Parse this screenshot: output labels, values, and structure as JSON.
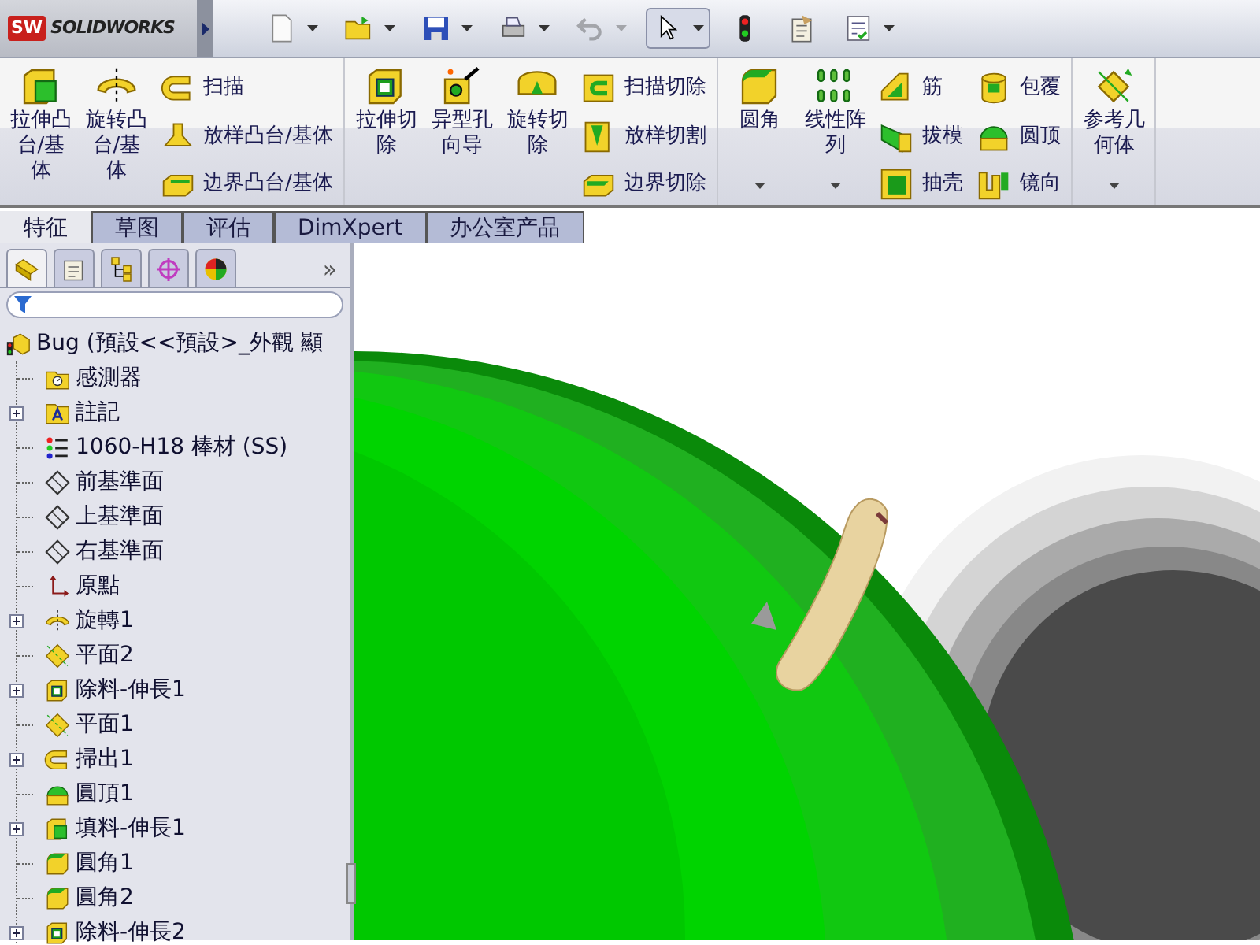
{
  "app": {
    "logo_mark": "SW",
    "logo_text": "SOLIDWORKS"
  },
  "quick_toolbar": [
    {
      "kind": "new",
      "dropdown": true,
      "disabled": false,
      "selected": false
    },
    {
      "kind": "open",
      "dropdown": true,
      "disabled": false,
      "selected": false
    },
    {
      "kind": "save",
      "dropdown": true,
      "disabled": false,
      "selected": false
    },
    {
      "kind": "print",
      "dropdown": true,
      "disabled": false,
      "selected": false
    },
    {
      "kind": "undo",
      "dropdown": true,
      "disabled": true,
      "selected": false
    },
    {
      "kind": "select",
      "dropdown": true,
      "disabled": false,
      "selected": true
    },
    {
      "kind": "rebuild",
      "dropdown": false,
      "disabled": false,
      "selected": false
    },
    {
      "kind": "options",
      "dropdown": false,
      "disabled": false,
      "selected": false
    },
    {
      "kind": "checklist",
      "dropdown": true,
      "disabled": false,
      "selected": false
    }
  ],
  "ribbon": {
    "groups": [
      {
        "columns": [
          {
            "kind": "large",
            "items": [
              {
                "label": "拉伸凸台/基体",
                "kind": "extrude",
                "dropdown": false
              }
            ]
          },
          {
            "kind": "large",
            "items": [
              {
                "label": "旋转凸台/基体",
                "kind": "revolve",
                "dropdown": false
              }
            ]
          },
          {
            "kind": "stack",
            "items": [
              {
                "label": "扫描",
                "kind": "sweep"
              },
              {
                "label": "放样凸台/基体",
                "kind": "loft"
              },
              {
                "label": "边界凸台/基体",
                "kind": "boundary"
              }
            ]
          }
        ]
      },
      {
        "columns": [
          {
            "kind": "large",
            "items": [
              {
                "label": "拉伸切除",
                "kind": "cut",
                "dropdown": false
              }
            ]
          },
          {
            "kind": "large",
            "items": [
              {
                "label": "异型孔向导",
                "kind": "hole",
                "dropdown": false
              }
            ]
          },
          {
            "kind": "large",
            "items": [
              {
                "label": "旋转切除",
                "kind": "revcut",
                "dropdown": false
              }
            ]
          },
          {
            "kind": "stack",
            "items": [
              {
                "label": "扫描切除",
                "kind": "sweepcut"
              },
              {
                "label": "放样切割",
                "kind": "loftcut"
              },
              {
                "label": "边界切除",
                "kind": "boundarycut"
              }
            ]
          }
        ]
      },
      {
        "columns": [
          {
            "kind": "large",
            "items": [
              {
                "label": "圆角",
                "kind": "fillet",
                "dropdown": true
              }
            ]
          },
          {
            "kind": "large",
            "items": [
              {
                "label": "线性阵列",
                "kind": "pattern",
                "dropdown": true
              }
            ]
          },
          {
            "kind": "stack",
            "items": [
              {
                "label": "筋",
                "kind": "rib"
              },
              {
                "label": "拔模",
                "kind": "draft"
              },
              {
                "label": "抽壳",
                "kind": "shell"
              }
            ]
          },
          {
            "kind": "stack",
            "items": [
              {
                "label": "包覆",
                "kind": "wrap"
              },
              {
                "label": "圆顶",
                "kind": "dome"
              },
              {
                "label": "镜向",
                "kind": "mirror"
              }
            ]
          }
        ]
      },
      {
        "columns": [
          {
            "kind": "large",
            "items": [
              {
                "label": "参考几何体",
                "kind": "refgeom",
                "dropdown": true
              }
            ]
          }
        ]
      }
    ]
  },
  "command_tabs": [
    {
      "label": "特征",
      "selected": true
    },
    {
      "label": "草图",
      "selected": false
    },
    {
      "label": "评估",
      "selected": false
    },
    {
      "label": "DimXpert",
      "selected": false
    },
    {
      "label": "办公室产品",
      "selected": false
    }
  ],
  "panel_tabs": [
    {
      "kind": "tree",
      "selected": true
    },
    {
      "kind": "property",
      "selected": false
    },
    {
      "kind": "config",
      "selected": false
    },
    {
      "kind": "target",
      "selected": false
    },
    {
      "kind": "display",
      "selected": false
    }
  ],
  "panel_more": "»",
  "tree": [
    {
      "label": "Bug  (預設<<預設>_外觀 顯",
      "kind": "part",
      "expandable": false,
      "children": [
        {
          "label": "感測器",
          "kind": "sensor",
          "expandable": false
        },
        {
          "label": "註記",
          "kind": "annotation",
          "expandable": true
        },
        {
          "label": "1060-H18 棒材 (SS)",
          "kind": "material",
          "expandable": false
        },
        {
          "label": "前基準面",
          "kind": "plane",
          "expandable": false
        },
        {
          "label": "上基準面",
          "kind": "plane",
          "expandable": false
        },
        {
          "label": "右基準面",
          "kind": "plane",
          "expandable": false
        },
        {
          "label": "原點",
          "kind": "origin",
          "expandable": false
        },
        {
          "label": "旋轉1",
          "kind": "revolve",
          "expandable": true
        },
        {
          "label": "平面2",
          "kind": "refplane",
          "expandable": false
        },
        {
          "label": "除料-伸長1",
          "kind": "cut",
          "expandable": true
        },
        {
          "label": "平面1",
          "kind": "refplane",
          "expandable": false
        },
        {
          "label": "掃出1",
          "kind": "sweep",
          "expandable": true
        },
        {
          "label": "圓頂1",
          "kind": "dome",
          "expandable": false
        },
        {
          "label": "填料-伸長1",
          "kind": "extrude",
          "expandable": true
        },
        {
          "label": "圓角1",
          "kind": "fillet",
          "expandable": false
        },
        {
          "label": "圓角2",
          "kind": "fillet",
          "expandable": false
        },
        {
          "label": "除料-伸長2",
          "kind": "cut",
          "expandable": true
        }
      ]
    }
  ]
}
